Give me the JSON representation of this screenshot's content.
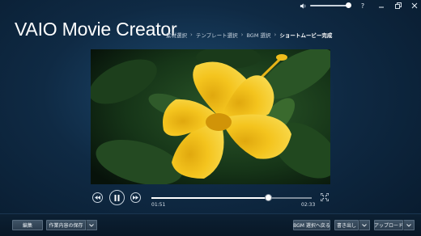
{
  "window": {
    "help_label": "?",
    "volume_level": 0.92
  },
  "header": {
    "app_title": "VAIO Movie Creator",
    "breadcrumb": [
      {
        "label": "素材選択"
      },
      {
        "label": "テンプレート選択"
      },
      {
        "label": "BGM 選択"
      },
      {
        "label": "ショートムービー完成"
      }
    ]
  },
  "player": {
    "current_time": "01:51",
    "total_time": "02:33",
    "progress": 0.7255,
    "state": "playing"
  },
  "toolbar": {
    "edit_label": "編集",
    "save_label": "作業内容の保存",
    "bgm_back_label": "BGM 選択へ戻る",
    "export_label": "書き出し",
    "upload_label": "アップロード"
  },
  "icons": {
    "speaker": "speaker-icon",
    "minimize": "minimize-icon",
    "restore": "restore-icon",
    "close": "close-icon",
    "rewind": "rewind-icon",
    "pause": "pause-icon",
    "forward": "fast-forward-icon",
    "fullscreen": "fullscreen-icon",
    "chevron": "chevron-down-icon"
  },
  "colors": {
    "background": "#0f2a44",
    "flower": "#f2c21a",
    "leaves": "#1f4a22"
  }
}
